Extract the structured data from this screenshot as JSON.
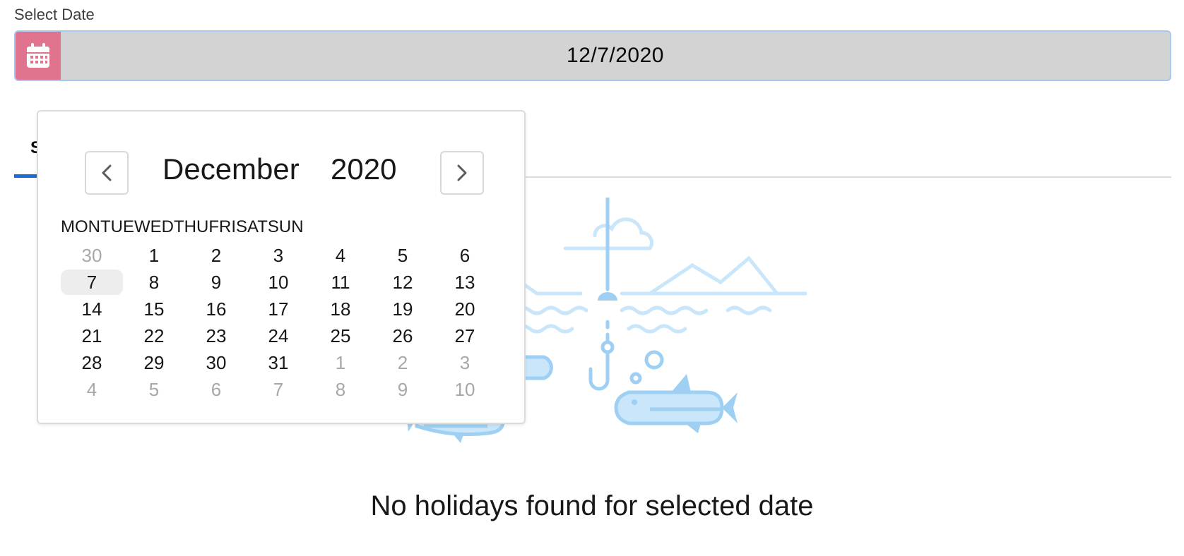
{
  "field": {
    "label": "Select Date",
    "value": "12/7/2020",
    "icon": "calendar-icon",
    "accent_color": "#e0748f"
  },
  "tabs": {
    "active_label": "S",
    "accent_color": "#1b6bd0"
  },
  "picker": {
    "month": "December",
    "year": "2020",
    "prev_icon": "chevron-left-icon",
    "next_icon": "chevron-right-icon",
    "weekdays": [
      "MON",
      "TUE",
      "WED",
      "THU",
      "FRI",
      "SAT",
      "SUN"
    ],
    "weeks": [
      [
        {
          "d": "30",
          "muted": true
        },
        {
          "d": "1"
        },
        {
          "d": "2"
        },
        {
          "d": "3"
        },
        {
          "d": "4"
        },
        {
          "d": "5"
        },
        {
          "d": "6"
        }
      ],
      [
        {
          "d": "7",
          "selected": true
        },
        {
          "d": "8"
        },
        {
          "d": "9"
        },
        {
          "d": "10"
        },
        {
          "d": "11"
        },
        {
          "d": "12"
        },
        {
          "d": "13"
        }
      ],
      [
        {
          "d": "14"
        },
        {
          "d": "15"
        },
        {
          "d": "16"
        },
        {
          "d": "17"
        },
        {
          "d": "18"
        },
        {
          "d": "19"
        },
        {
          "d": "20"
        }
      ],
      [
        {
          "d": "21"
        },
        {
          "d": "22"
        },
        {
          "d": "23"
        },
        {
          "d": "24"
        },
        {
          "d": "25"
        },
        {
          "d": "26"
        },
        {
          "d": "27"
        }
      ],
      [
        {
          "d": "28"
        },
        {
          "d": "29"
        },
        {
          "d": "30"
        },
        {
          "d": "31"
        },
        {
          "d": "1",
          "muted": true
        },
        {
          "d": "2",
          "muted": true
        },
        {
          "d": "3",
          "muted": true
        }
      ],
      [
        {
          "d": "4",
          "muted": true
        },
        {
          "d": "5",
          "muted": true
        },
        {
          "d": "6",
          "muted": true
        },
        {
          "d": "7",
          "muted": true
        },
        {
          "d": "8",
          "muted": true
        },
        {
          "d": "9",
          "muted": true
        },
        {
          "d": "10",
          "muted": true
        }
      ]
    ]
  },
  "empty_state": {
    "message": "No holidays found for selected date",
    "illustration": "fishing-illustration",
    "illustration_color": "#9fd0f3"
  }
}
